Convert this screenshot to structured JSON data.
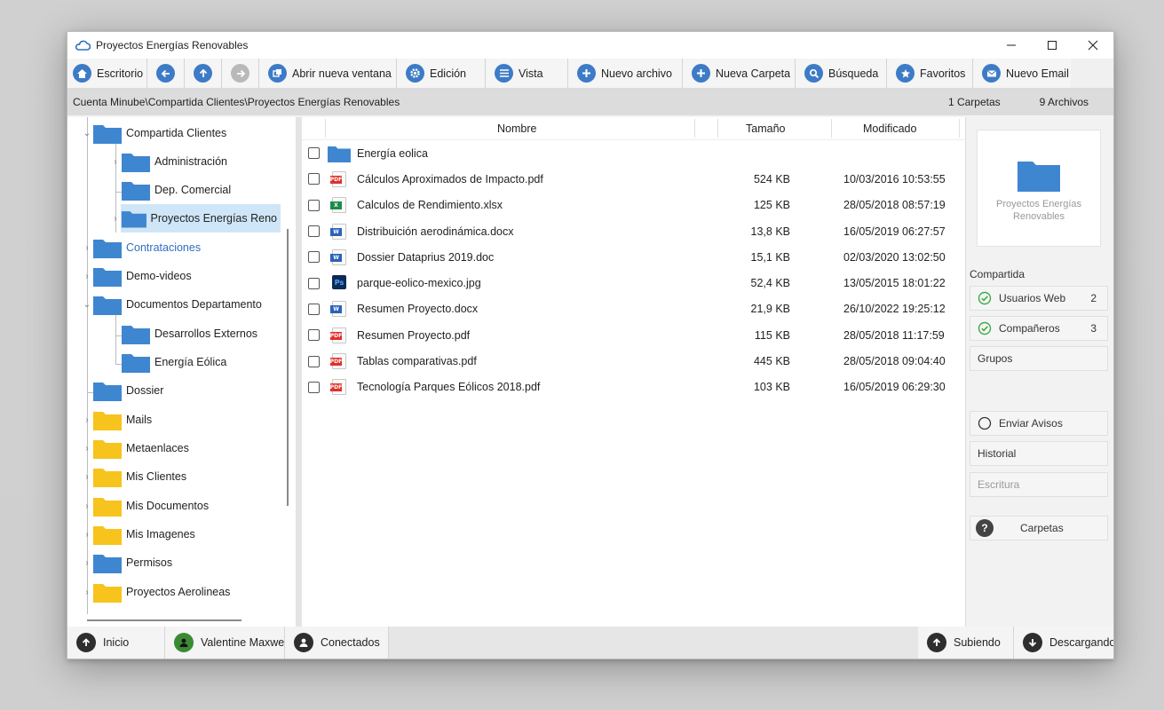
{
  "window": {
    "title": "Proyectos Energías Renovables"
  },
  "toolbar": {
    "desktop": "Escritorio",
    "new_window": "Abrir nueva ventana",
    "edit": "Edición",
    "view": "Vista",
    "new_file": "Nuevo archivo",
    "new_folder": "Nueva Carpeta",
    "search": "Búsqueda",
    "favorites": "Favoritos",
    "new_email": "Nuevo Email"
  },
  "pathbar": {
    "path": "Cuenta Minube\\Compartida Clientes\\Proyectos Energías Renovables",
    "folders_count": "1 Carpetas",
    "files_count": "9 Archivos"
  },
  "tree": {
    "items": [
      {
        "label": "Compartida Clientes"
      },
      {
        "label": "Administración"
      },
      {
        "label": "Dep. Comercial"
      },
      {
        "label": "Proyectos Energías Reno"
      },
      {
        "label": "Contrataciones"
      },
      {
        "label": "Demo-videos"
      },
      {
        "label": "Documentos Departamento"
      },
      {
        "label": "Desarrollos Externos"
      },
      {
        "label": "Energía Eólica"
      },
      {
        "label": "Dossier"
      },
      {
        "label": "Mails"
      },
      {
        "label": "Metaenlaces"
      },
      {
        "label": "Mis Clientes"
      },
      {
        "label": "Mis Documentos"
      },
      {
        "label": "Mis Imagenes"
      },
      {
        "label": "Permisos"
      },
      {
        "label": "Proyectos Aerolineas"
      }
    ]
  },
  "files": {
    "headers": {
      "name": "Nombre",
      "size": "Tamaño",
      "modified": "Modificado"
    },
    "rows": [
      {
        "name": "Energía eolica",
        "size": "",
        "date": "",
        "type": "folder"
      },
      {
        "name": "Cálculos Aproximados de Impacto.pdf",
        "size": "524 KB",
        "date": "10/03/2016 10:53:55",
        "type": "pdf"
      },
      {
        "name": "Calculos de Rendimiento.xlsx",
        "size": "125 KB",
        "date": "28/05/2018 08:57:19",
        "type": "xlsx"
      },
      {
        "name": "Distribuición aerodinámica.docx",
        "size": "13,8 KB",
        "date": "16/05/2019 06:27:57",
        "type": "doc"
      },
      {
        "name": "Dossier Dataprius 2019.doc",
        "size": "15,1 KB",
        "date": "02/03/2020 13:02:50",
        "type": "doc"
      },
      {
        "name": "parque-eolico-mexico.jpg",
        "size": "52,4 KB",
        "date": "13/05/2015 18:01:22",
        "type": "ps"
      },
      {
        "name": "Resumen Proyecto.docx",
        "size": "21,9 KB",
        "date": "26/10/2022 19:25:12",
        "type": "doc"
      },
      {
        "name": "Resumen Proyecto.pdf",
        "size": "115 KB",
        "date": "28/05/2018 11:17:59",
        "type": "pdf"
      },
      {
        "name": "Tablas comparativas.pdf",
        "size": "445 KB",
        "date": "28/05/2018 09:04:40",
        "type": "pdf"
      },
      {
        "name": "Tecnología Parques Eólicos 2018.pdf",
        "size": "103 KB",
        "date": "16/05/2019 06:29:30",
        "type": "pdf"
      }
    ]
  },
  "side": {
    "preview_name": "Proyectos Energías Renovables",
    "shared_label": "Compartida",
    "web_users": "Usuarios Web",
    "web_users_count": "2",
    "colleagues": "Compañeros",
    "colleagues_count": "3",
    "groups": "Grupos",
    "send_notices": "Enviar Avisos",
    "history": "Historial",
    "write": "Escritura",
    "folders": "Carpetas"
  },
  "bottom": {
    "home": "Inicio",
    "user": "Valentine Maxwell",
    "connected": "Conectados",
    "uploading": "Subiendo",
    "downloading": "Descargando"
  },
  "colors": {
    "accent": "#3d7bc6",
    "folder_blue": "#3f86d0",
    "folder_yellow": "#f7c31d",
    "pdf_red": "#e0302a"
  }
}
